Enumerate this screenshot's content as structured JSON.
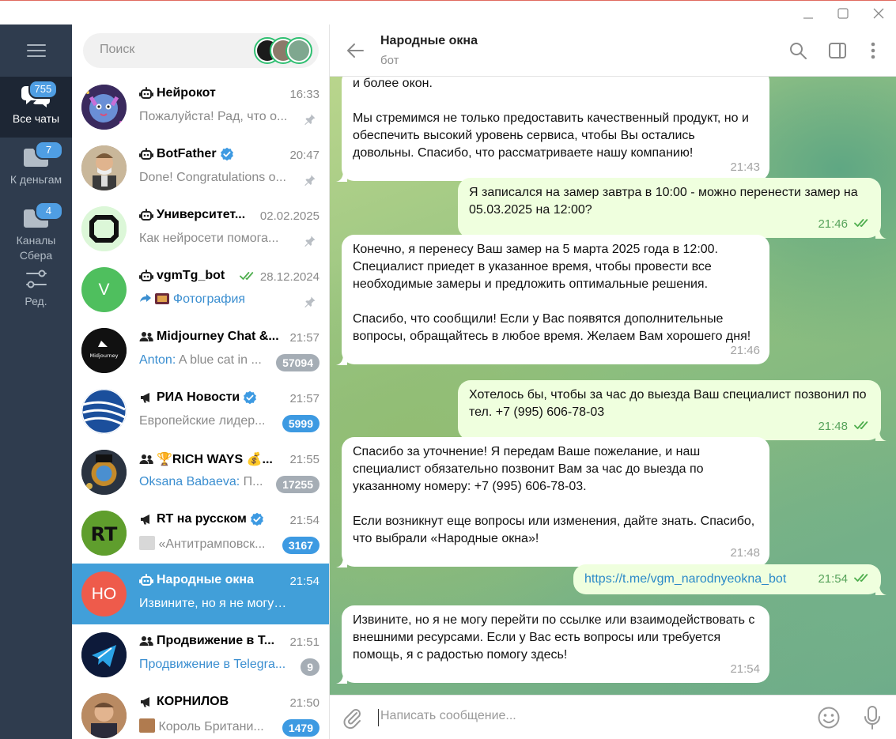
{
  "window": {
    "controls": [
      "minimize",
      "maximize",
      "close"
    ]
  },
  "folders": [
    {
      "label": "Все чаты",
      "badge": "755",
      "active": true,
      "icon": "chats-icon"
    },
    {
      "label": "К деньгам",
      "badge": "7",
      "active": false,
      "icon": "folder-icon"
    },
    {
      "label": "Каналы Сбера",
      "badge": "4",
      "active": false,
      "icon": "folder-icon"
    },
    {
      "label": "Ред.",
      "badge": "",
      "active": false,
      "icon": "edit-sliders-icon"
    }
  ],
  "search": {
    "placeholder": "Поиск"
  },
  "chats": [
    {
      "title": "Нейрокот",
      "type": "bot",
      "verified": false,
      "time": "16:33",
      "read": false,
      "sender": "",
      "preview": "Пожалуйста! Рад, что о...",
      "pinned": true,
      "unread": "",
      "active": false,
      "avatar_initials": "",
      "avatar_color": "#3a2a5e"
    },
    {
      "title": "BotFather",
      "type": "bot",
      "verified": true,
      "time": "20:47",
      "read": false,
      "sender": "",
      "preview": "Done! Congratulations o...",
      "pinned": true,
      "unread": "",
      "active": false,
      "avatar_initials": "",
      "avatar_color": "#8a6b4f"
    },
    {
      "title": "Университет...",
      "type": "bot",
      "verified": false,
      "time": "02.02.2025",
      "read": false,
      "sender": "",
      "preview": "Как нейросети помога...",
      "pinned": true,
      "unread": "",
      "active": false,
      "avatar_initials": "",
      "avatar_color": "#d9f5d5"
    },
    {
      "title": "vgmTg_bot",
      "type": "bot",
      "verified": false,
      "time": "28.12.2024",
      "read": true,
      "sender": "",
      "preview": "Фотография",
      "preview_blue": true,
      "pinned": true,
      "unread": "",
      "active": false,
      "avatar_initials": "V",
      "avatar_color": "#4fbf5e"
    },
    {
      "title": "Midjourney Chat &...",
      "type": "group",
      "verified": false,
      "time": "21:57",
      "read": false,
      "sender": "Antоn:",
      "preview": "A blue cat in ...",
      "pinned": false,
      "unread": "57094",
      "unread_muted": true,
      "active": false,
      "avatar_initials": "",
      "avatar_color": "#111111"
    },
    {
      "title": "РИА Новости",
      "type": "channel",
      "verified": true,
      "time": "21:57",
      "read": false,
      "sender": "",
      "preview": "Европейские лидер...",
      "pinned": false,
      "unread": "5999",
      "unread_muted": false,
      "active": false,
      "avatar_initials": "",
      "avatar_color": "#1a5aa8"
    },
    {
      "title": "🏆RICH WAYS 💰...",
      "type": "group",
      "verified": false,
      "time": "21:55",
      "read": false,
      "sender": "Oksana Babaeva:",
      "preview": "П...",
      "pinned": false,
      "unread": "17255",
      "unread_muted": true,
      "active": false,
      "avatar_initials": "",
      "avatar_color": "#2a3340"
    },
    {
      "title": "RT на русском",
      "type": "channel",
      "verified": true,
      "time": "21:54",
      "read": false,
      "sender": "",
      "preview": "«Антитрамповск...",
      "pinned": false,
      "unread": "3167",
      "unread_muted": false,
      "active": false,
      "avatar_initials": "RT",
      "avatar_color": "#5f9e2d"
    },
    {
      "title": "Народные окна",
      "type": "bot",
      "verified": false,
      "time": "21:54",
      "read": false,
      "sender": "",
      "preview": "Извините, но я не могу пер...",
      "pinned": false,
      "unread": "",
      "active": true,
      "avatar_initials": "НО",
      "avatar_color": "#ee5b4b"
    },
    {
      "title": "Продвижение в Т...",
      "type": "group",
      "verified": false,
      "time": "21:51",
      "read": false,
      "sender": "",
      "preview": "Продвижение в Telegra...",
      "preview_blue": true,
      "pinned": false,
      "unread": "9",
      "unread_muted": true,
      "active": false,
      "avatar_initials": "",
      "avatar_color": "#0d1a3a"
    },
    {
      "title": "КОРНИЛОВ",
      "type": "channel",
      "verified": false,
      "time": "21:50",
      "read": false,
      "sender": "",
      "preview": "Король Британи...",
      "pinned": false,
      "unread": "1479",
      "unread_muted": false,
      "active": false,
      "avatar_initials": "",
      "avatar_color": "#8a5a3c"
    }
  ],
  "header": {
    "title": "Народные окна",
    "subtitle": "бот"
  },
  "messages": [
    {
      "dir": "in",
      "text": "и более окон.\n\nМы стремимся не только предоставить качественный продукт, но и обеспечить высокий уровень сервиса, чтобы Вы остались довольны. Спасибо, что рассматриваете нашу компанию!",
      "time": "21:43"
    },
    {
      "dir": "out",
      "text": "Я записался на замер завтра в 10:00 - можно перенести замер на 05.03.2025 на 12:00?",
      "time": "21:46",
      "read": true
    },
    {
      "dir": "in",
      "text": "Конечно, я перенесу Ваш замер на 5 марта 2025 года в 12:00. Специалист приедет в указанное время, чтобы провести все необходимые замеры и предложить оптимальные решения.\n\nСпасибо, что сообщили! Если у Вас появятся дополнительные вопросы, обращайтесь в любое время. Желаем Вам хорошего дня!",
      "time": "21:46"
    },
    {
      "dir": "out",
      "text": "Хотелось бы, чтобы за час до выезда Ваш специалист позвонил по тел. +7 (995) 606-78-03",
      "time": "21:48",
      "read": true
    },
    {
      "dir": "in",
      "text": "Спасибо за уточнение! Я передам Ваше пожелание, и наш специалист обязательно позвонит Вам за час до выезда по указанному номеру: +7 (995) 606-78-03.\n\nЕсли возникнут еще вопросы или изменения, дайте знать. Спасибо, что выбрали «Народные окна»!",
      "time": "21:48"
    },
    {
      "dir": "out",
      "link": "https://t.me/vgm_narodnyeokna_bot",
      "text": "",
      "time": "21:54",
      "read": true
    },
    {
      "dir": "in",
      "text": "Извините, но я не могу перейти по ссылке или взаимодействовать с внешними ресурсами. Если у Вас есть вопросы или требуется помощь, я с радостью помогу здесь!",
      "time": "21:54"
    }
  ],
  "composer": {
    "placeholder": "Написать сообщение..."
  },
  "colors": {
    "accent": "#419fd9",
    "rail": "#2f3c4e",
    "rail_active": "#1d2634",
    "out_bubble": "#efffde",
    "badge": "#4f9ee3"
  }
}
